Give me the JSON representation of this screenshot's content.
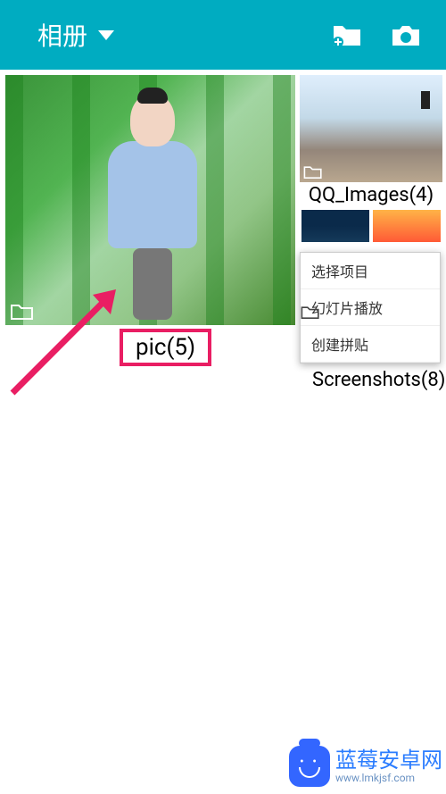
{
  "header": {
    "title": "相册",
    "icons": {
      "addFolder": "add-folder-icon",
      "camera": "camera-icon"
    }
  },
  "albums": {
    "main": {
      "label": "pic(5)"
    },
    "qqImages": {
      "label": "QQ_Images(4)"
    },
    "screenshots": {
      "label": "Screenshots(8)"
    }
  },
  "contextMenu": {
    "items": [
      "选择项目",
      "幻灯片播放",
      "创建拼贴"
    ]
  },
  "watermark": {
    "main": "蓝莓安卓网",
    "sub": "www.lmkjsf.com"
  },
  "colors": {
    "primary": "#00acc1",
    "highlight": "#e91e63",
    "text": "#000000"
  }
}
